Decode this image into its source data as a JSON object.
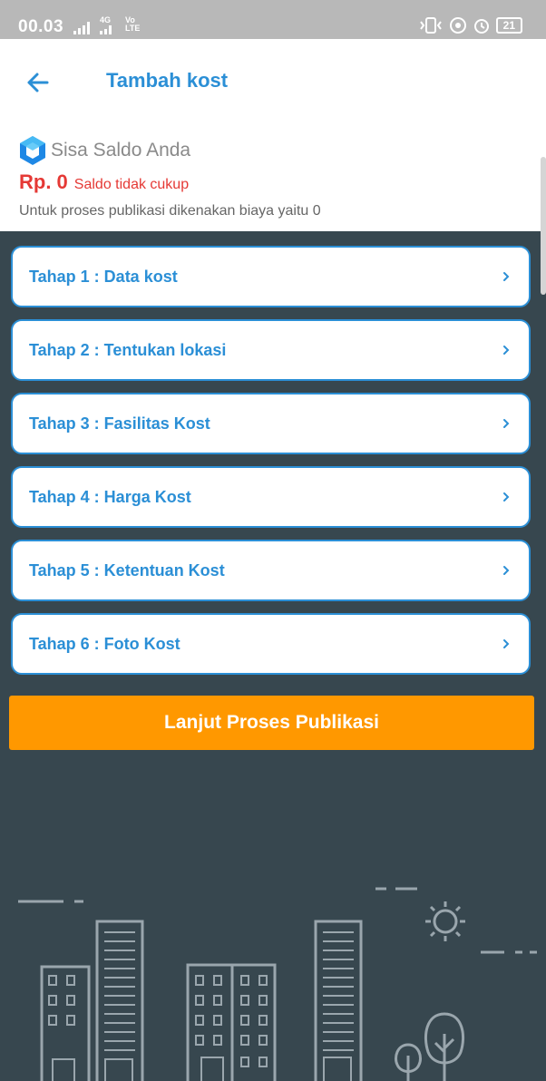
{
  "status_bar": {
    "time": "00.03",
    "network_1": "4G",
    "network_2": "Vo LTE",
    "battery": "21"
  },
  "header": {
    "title": "Tambah kost",
    "back_icon": "arrow-left-icon"
  },
  "saldo": {
    "title": "Sisa Saldo Anda",
    "amount": "Rp. 0",
    "warning": "Saldo tidak cukup",
    "note": "Untuk proses publikasi dikenakan biaya yaitu 0",
    "logo_icon": "hexagon-logo-icon"
  },
  "steps": [
    {
      "label": "Tahap 1 : Data kost"
    },
    {
      "label": "Tahap 2 : Tentukan lokasi"
    },
    {
      "label": "Tahap 3 : Fasilitas Kost"
    },
    {
      "label": "Tahap 4 : Harga Kost"
    },
    {
      "label": "Tahap 5 : Ketentuan Kost"
    },
    {
      "label": "Tahap 6 : Foto Kost"
    }
  ],
  "publish_button": "Lanjut Proses Publikasi",
  "colors": {
    "primary": "#2b8fd6",
    "accent": "#ff9800",
    "danger": "#e53935",
    "background": "#37474f"
  }
}
